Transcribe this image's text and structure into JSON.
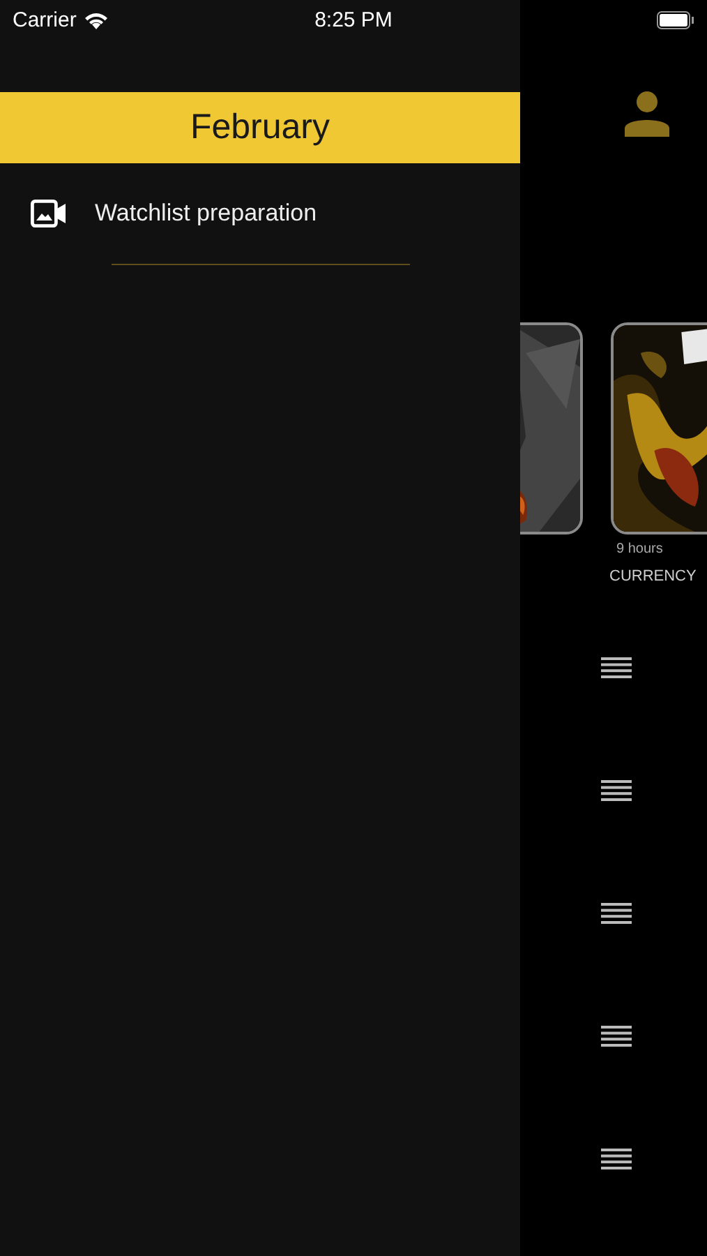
{
  "status_bar": {
    "carrier": "Carrier",
    "time": "8:25 PM"
  },
  "drawer": {
    "title": "February",
    "items": [
      {
        "label": "Watchlist preparation",
        "kind": "video"
      }
    ]
  },
  "feed": {
    "cards": [
      {
        "kind": "picture"
      },
      {
        "kind": "picture",
        "age": "9 hours",
        "category": "CURRENCY"
      }
    ]
  },
  "sections": [
    {
      "kind": "reorder"
    },
    {
      "kind": "reorder"
    },
    {
      "kind": "reorder"
    },
    {
      "kind": "reorder"
    },
    {
      "kind": "reorder"
    }
  ]
}
